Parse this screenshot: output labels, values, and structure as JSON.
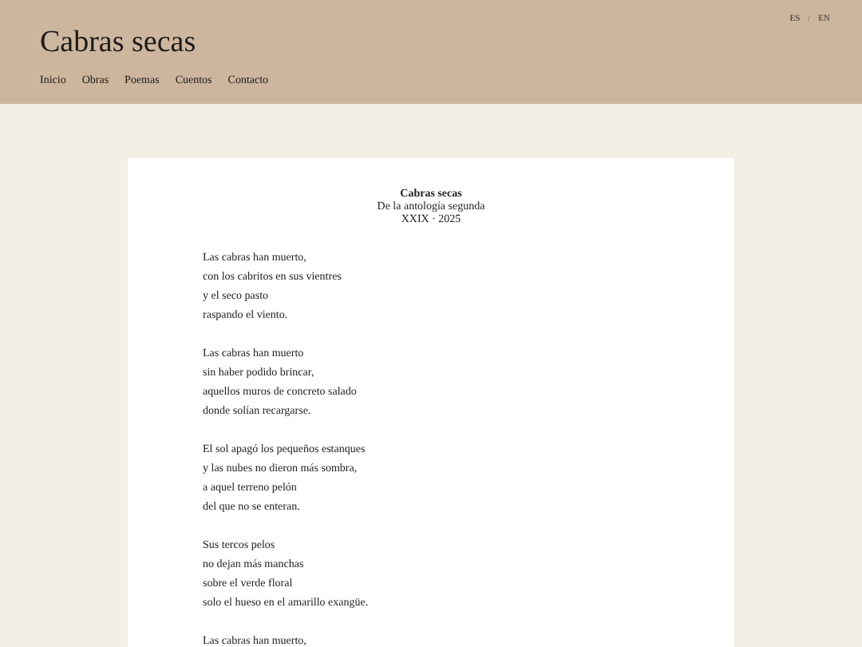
{
  "site_title": "Cabras secas",
  "nav": [
    "Inicio",
    "Obras",
    "Poemas",
    "Cuentos",
    "Contacto"
  ],
  "languages": [
    "ES",
    "EN"
  ],
  "language_separator": "/",
  "poem": {
    "title": "Cabras secas",
    "subtitle": "De la antología segunda",
    "date": "XXIX · 2025",
    "stanzas": [
      [
        "Las cabras han muerto,",
        "con los cabritos en sus vientres",
        "y el seco pasto",
        "raspando el viento."
      ],
      [
        "Las cabras han muerto",
        "sin haber podido brincar,",
        "aquellos muros de concreto salado",
        "donde solían recargarse."
      ],
      [
        "El sol apagó los pequeños estanques",
        "y las nubes no dieron más sombra,",
        "a aquel terreno pelón",
        "del que no se enteran."
      ],
      [
        "Sus tercos pelos",
        "no dejan más manchas",
        "sobre el verde floral",
        "solo el hueso en el amarillo exangüe."
      ],
      [
        "Las cabras han muerto,"
      ]
    ]
  }
}
